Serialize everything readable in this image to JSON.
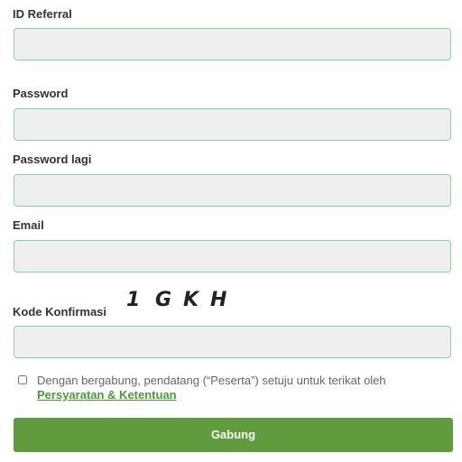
{
  "form": {
    "referral": {
      "label": "ID Referral",
      "value": "",
      "placeholder": ""
    },
    "password": {
      "label": "Password",
      "value": "",
      "placeholder": ""
    },
    "password_again": {
      "label": "Password lagi",
      "value": "",
      "placeholder": ""
    },
    "email": {
      "label": "Email",
      "value": "",
      "placeholder": ""
    },
    "captcha": {
      "label": "Kode Konfirmasi",
      "chars": [
        "1",
        "G",
        "K",
        "H"
      ],
      "value": "",
      "placeholder": ""
    },
    "terms": {
      "checked": false,
      "text": "Dengan bergabung, pendatang (“Peserta”) setuju untuk terikat oleh",
      "link": "Persyaratan & Ketentuan"
    },
    "submit_label": "Gabung"
  },
  "colors": {
    "field_background": "#efefef",
    "field_border": "#86d3a8",
    "button": "#609b3e",
    "link": "#4a9a36"
  }
}
